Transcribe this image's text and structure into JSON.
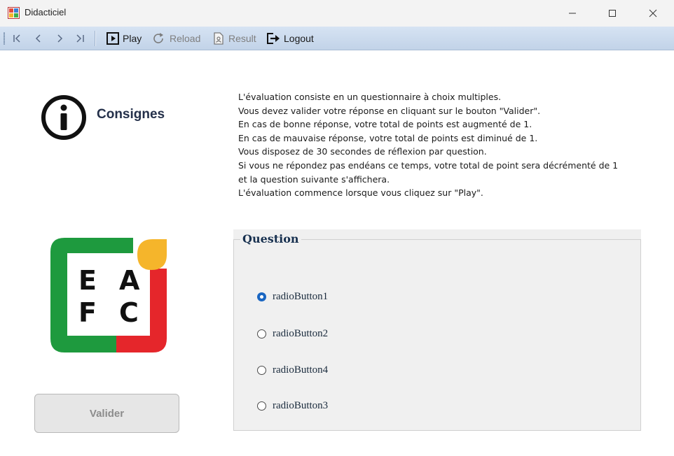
{
  "window": {
    "title": "Didacticiel"
  },
  "toolbar": {
    "nav_first_icon": "⏮",
    "nav_first": "|<",
    "nav_prev": "<",
    "nav_next": ">",
    "nav_last": ">|",
    "play_label": "Play",
    "reload_label": "Reload",
    "result_label": "Result",
    "logout_label": "Logout"
  },
  "consignes": {
    "title": "Consignes",
    "icon": "info-icon"
  },
  "instructions": [
    "L'évaluation consiste en un questionnaire à choix multiples.",
    "Vous devez valider votre réponse en cliquant sur le bouton \"Valider\".",
    "En cas de bonne réponse, votre total de points est augmenté de 1.",
    "En cas de mauvaise réponse, votre total de points est diminué de 1.",
    "Vous disposez de 30 secondes de réflexion par question.",
    "Si vous ne répondez pas endéans ce temps, votre total de point sera décrémenté de 1",
    "et la question suivante s'affichera.",
    "L'évaluation commence lorsque vous cliquez sur \"Play\"."
  ],
  "logo": {
    "letters": [
      "E",
      "A",
      "F",
      "C"
    ],
    "colors": {
      "green": "#1e9a3e",
      "red": "#e5262b",
      "yellow": "#f5b52b"
    }
  },
  "valider_label": "Valider",
  "question": {
    "title": "Question",
    "options": [
      {
        "label": "radioButton1",
        "checked": true
      },
      {
        "label": "radioButton2",
        "checked": false
      },
      {
        "label": "radioButton4",
        "checked": false
      },
      {
        "label": "radioButton3",
        "checked": false
      }
    ]
  },
  "colors": {
    "accent": "#1a66c2",
    "toolbar": "#c9d8ec"
  }
}
